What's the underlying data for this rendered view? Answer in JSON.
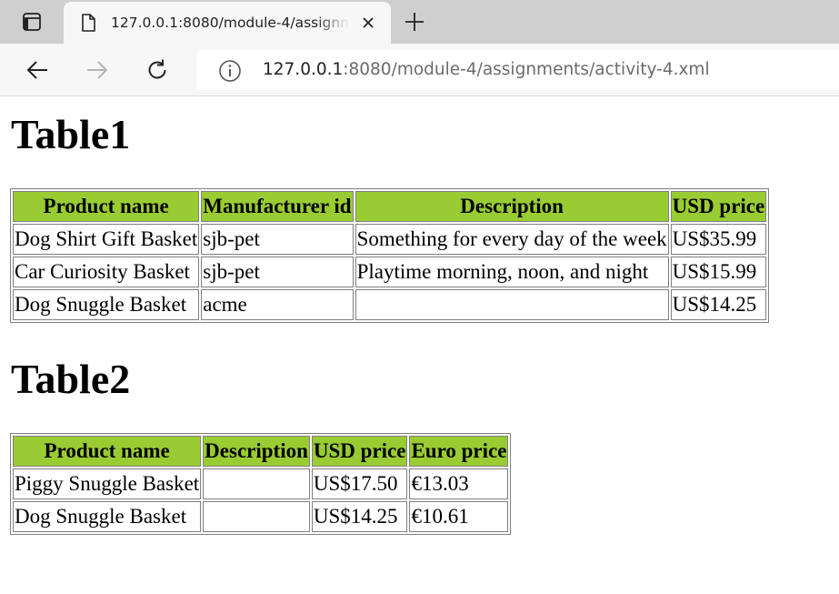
{
  "browser": {
    "tab": {
      "title": "127.0.0.1:8080/module-4/assignments/activity-4.xml"
    },
    "address": {
      "host": "127.0.0.1",
      "path": ":8080/module-4/assignments/activity-4.xml"
    }
  },
  "page": {
    "table1": {
      "heading": "Table1",
      "columns": [
        "Product name",
        "Manufacturer id",
        "Description",
        "USD price"
      ],
      "rows": [
        [
          "Dog Shirt Gift Basket",
          "sjb-pet",
          "Something for every day of the week",
          "US$35.99"
        ],
        [
          "Car Curiosity Basket",
          "sjb-pet",
          "Playtime morning, noon, and night",
          "US$15.99"
        ],
        [
          "Dog Snuggle Basket",
          "acme",
          "",
          "US$14.25"
        ]
      ]
    },
    "table2": {
      "heading": "Table2",
      "columns": [
        "Product name",
        "Description",
        "USD price",
        "Euro price"
      ],
      "rows": [
        [
          "Piggy Snuggle Basket",
          "",
          "US$17.50",
          "€13.03"
        ],
        [
          "Dog Snuggle Basket",
          "",
          "US$14.25",
          "€10.61"
        ]
      ]
    },
    "header_color": "#99cc33"
  }
}
